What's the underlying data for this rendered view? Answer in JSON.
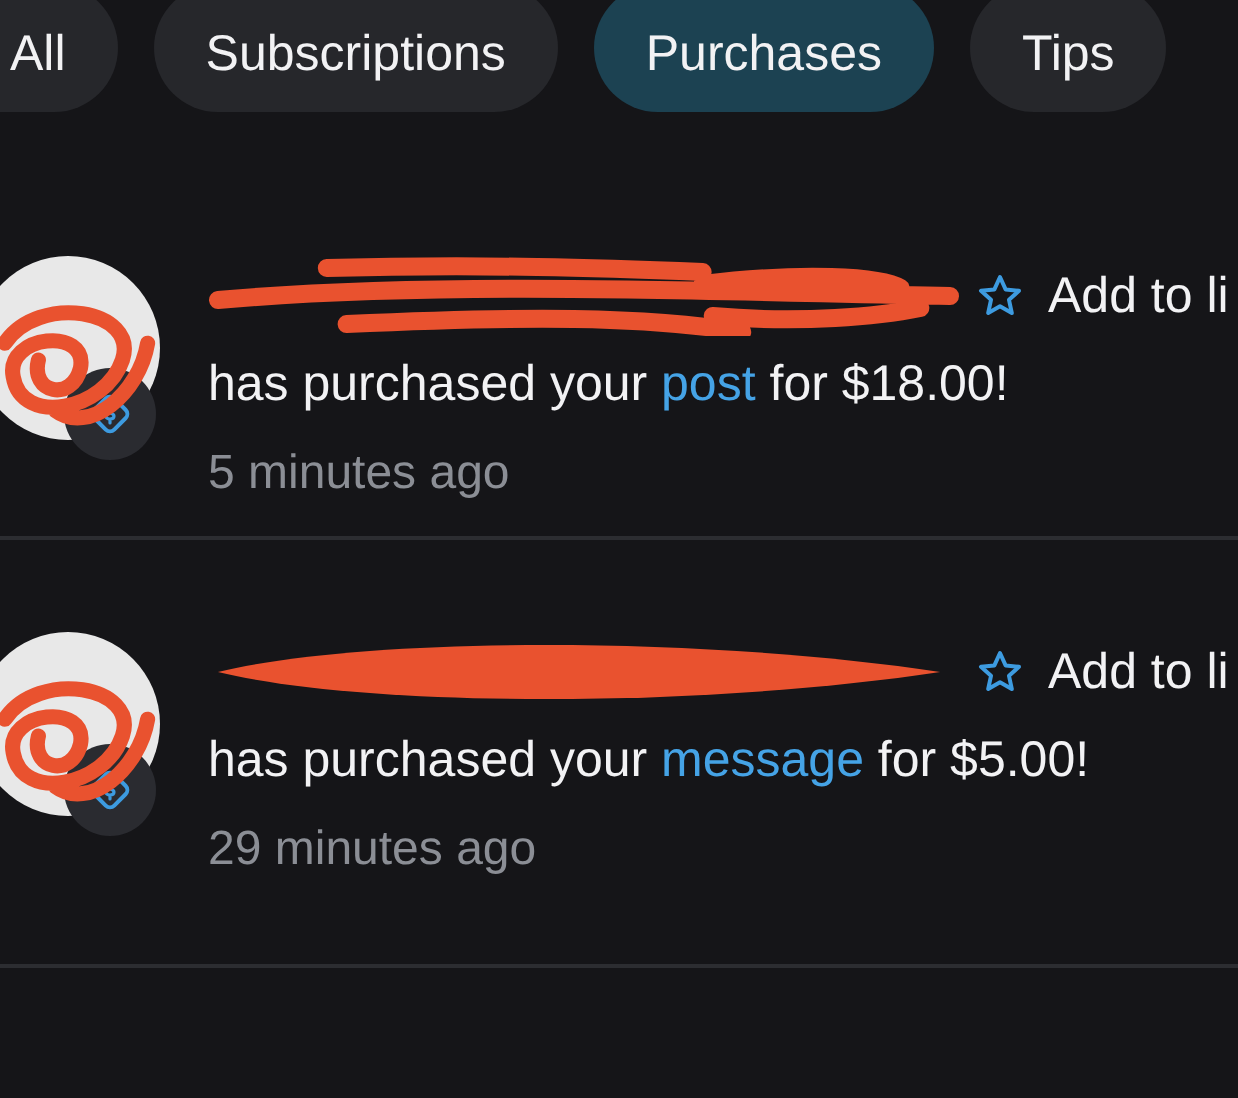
{
  "tabs": [
    {
      "label": "All",
      "selected": false
    },
    {
      "label": "Subscriptions",
      "selected": false
    },
    {
      "label": "Purchases",
      "selected": true
    },
    {
      "label": "Tips",
      "selected": false
    }
  ],
  "notifications": [
    {
      "action": "Add to li",
      "message_before": "has purchased your ",
      "link": "post",
      "message_after": " for $18.00!",
      "time": "5 minutes ago"
    },
    {
      "action": "Add to li",
      "message_before": "has purchased your ",
      "link": "message",
      "message_after": " for $5.00!",
      "time": "29 minutes ago"
    }
  ]
}
